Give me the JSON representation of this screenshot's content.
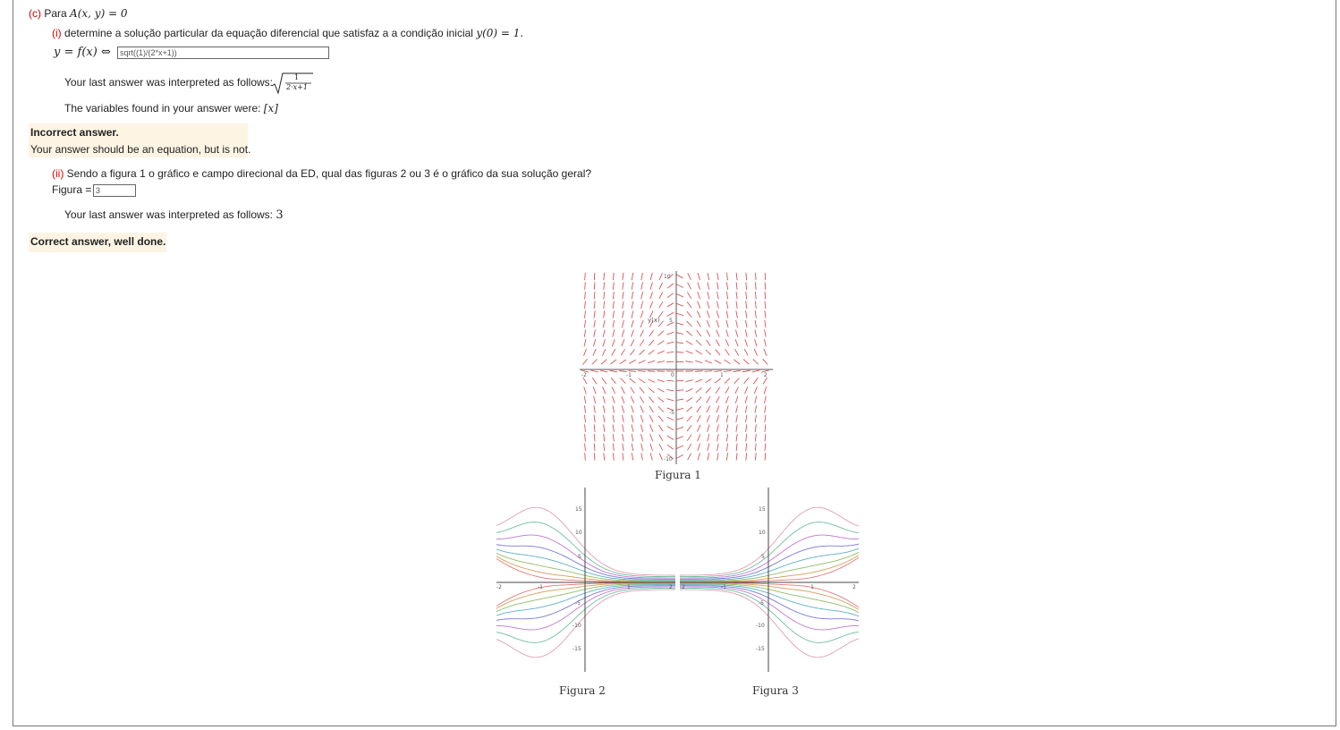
{
  "part_c": {
    "label": "(c)",
    "text": "Para",
    "condition": "A(x, y) = 0"
  },
  "part_i": {
    "label": "(i)",
    "question": "determine a solução particular da equação diferencial que satisfaz a a condição inicial",
    "initial_condition": "y(0) = 1.",
    "answer_prefix": "y = f(x) ⇔",
    "answer_value": "sqrt((1)/(2*x+1))",
    "interpreted_text": "Your last answer was interpreted as follows:",
    "interpreted_num": "1",
    "interpreted_den": "2·x+1",
    "variables_text": "The variables found in your answer were:",
    "variables_value": "[x]",
    "feedback_title": "Incorrect answer.",
    "feedback_detail": "Your answer should be an equation, but is not."
  },
  "part_ii": {
    "label": "(ii)",
    "question": "Sendo a figura 1 o gráfico e campo direcional da ED, qual das figuras 2 ou 3 é o gráfico da sua solução geral?",
    "answer_prefix": "Figura =",
    "answer_value": "3",
    "interpreted_text": "Your last answer was interpreted as follows:",
    "interpreted_value": "3",
    "feedback_title": "Correct answer, well done."
  },
  "figures": {
    "fig1_caption": "Figura 1",
    "fig2_caption": "Figura 2",
    "fig3_caption": "Figura 3",
    "fig1_ylabel": "y(x)",
    "fig1_ticks": {
      "y_top": "10",
      "y_mid": "5",
      "y_neg": "-5",
      "y_bottom": "-10",
      "x_left": "-2",
      "x_neg1": "-1",
      "x_zero": "0",
      "x_pos1": "1",
      "x_right": "2"
    },
    "fig2_ticks": {
      "y15": "15",
      "y10": "10",
      "y5": "5",
      "yn5": "-5",
      "yn10": "-10",
      "yn15": "-15",
      "xm2": "-2",
      "xm1": "-1",
      "x1": "1",
      "x2": "2"
    },
    "fig3_ticks": {
      "y15": "15",
      "y10": "10",
      "y5": "5",
      "yn5": "-5",
      "yn10": "-10",
      "yn15": "-15",
      "xm2": "-2",
      "xm1": "-1",
      "x1": "1",
      "x2": "2"
    },
    "curve_colors": [
      "#e07b7b",
      "#d4a05a",
      "#8fbf6a",
      "#5fb0c8",
      "#7a7ad8",
      "#c07ad0",
      "#6fbf9f",
      "#e0a0b0",
      "#90a0e0",
      "#b0c060"
    ],
    "field_color": "#d94040"
  }
}
